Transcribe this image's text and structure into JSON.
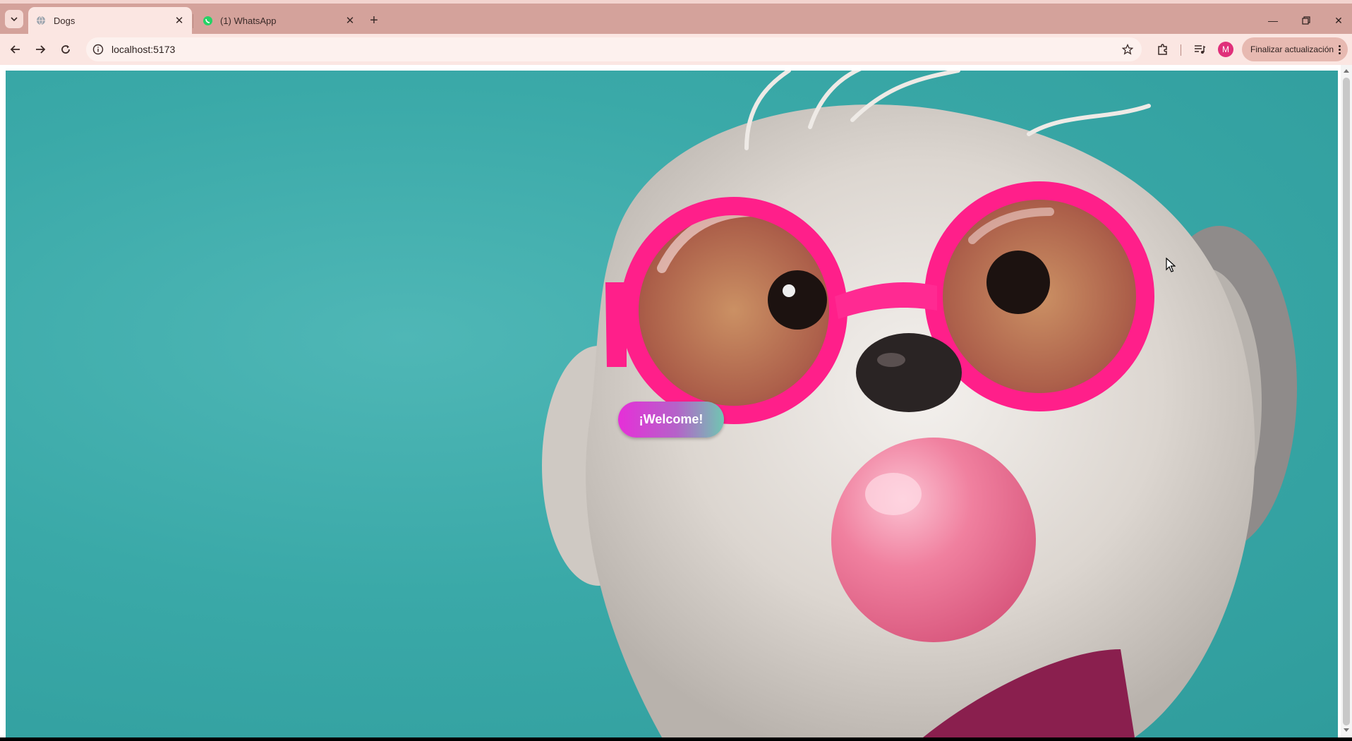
{
  "browser": {
    "tabs": [
      {
        "title": "Dogs",
        "active": true,
        "favicon": "globe-icon"
      },
      {
        "title": "(1) WhatsApp",
        "active": false,
        "favicon": "whatsapp-icon"
      }
    ],
    "address": "localhost:5173",
    "update_button_label": "Finalizar actualización",
    "profile_initial": "M"
  },
  "page": {
    "welcome_label": "¡Welcome!"
  },
  "colors": {
    "chrome_tabstrip": "#d4a29b",
    "chrome_toolbar": "#fbe6e2",
    "hero_background": "#3aa9a8",
    "button_gradient_start": "#e62fd8",
    "button_gradient_end": "#6fc7b2",
    "avatar": "#e0307a"
  }
}
